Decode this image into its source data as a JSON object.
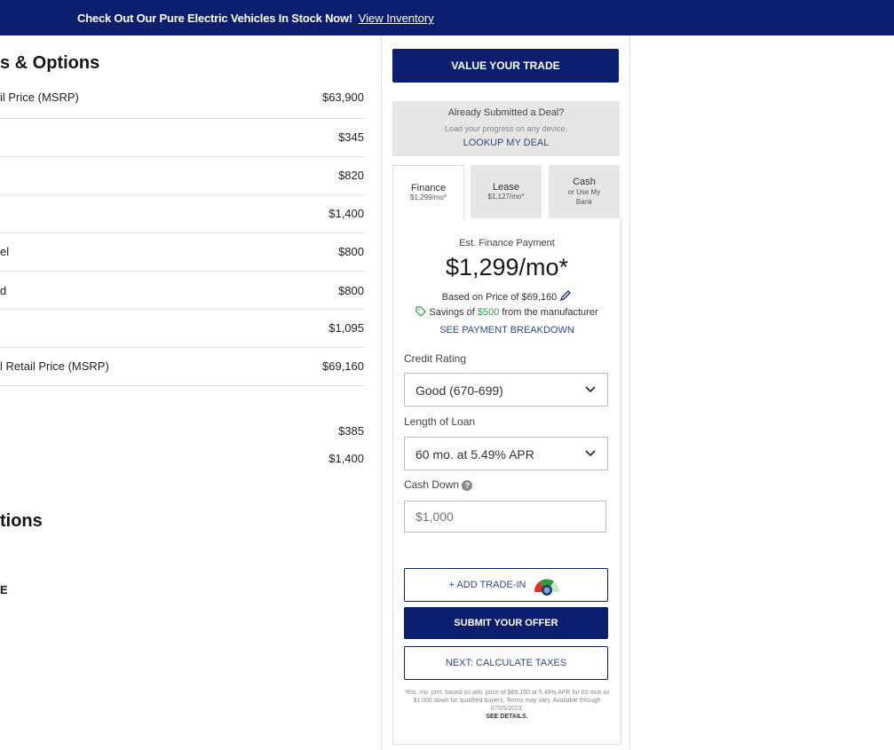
{
  "banner": {
    "message": "Check Out Our Pure Electric Vehicles In Stock Now!",
    "link": "View Inventory",
    "color": "#0b1f6e"
  },
  "pricing": {
    "section_title": "s & Options",
    "rows": [
      {
        "label": "il Price (MSRP)",
        "amount": "$63,900"
      },
      {
        "label": "",
        "amount": "$345"
      },
      {
        "label": "",
        "amount": "$820"
      },
      {
        "label": "",
        "amount": "$1,400"
      },
      {
        "label": "el",
        "amount": "$800"
      },
      {
        "label": "d",
        "amount": "$800"
      },
      {
        "label": "",
        "amount": "$1,095"
      },
      {
        "label": "l Retail Price (MSRP)",
        "amount": "$69,160"
      }
    ],
    "extra_rows": [
      {
        "label": "",
        "amount": "$385"
      },
      {
        "label": "",
        "amount": "$1,400"
      }
    ],
    "second_title": "tions",
    "fragment": "E"
  },
  "panel": {
    "value_trade": "VALUE YOUR TRADE",
    "deal": {
      "title": "Already Submitted a Deal?",
      "subtitle": "Load your progress on any device.",
      "link": "LOOKUP MY DEAL"
    },
    "tabs": [
      {
        "label": "Finance",
        "sub": "$1,299/mo*",
        "active": true
      },
      {
        "label": "Lease",
        "sub": "$1,127/mo*",
        "active": false
      },
      {
        "label": "Cash",
        "sub": "or Use My Bank",
        "active": false
      }
    ],
    "estimate": {
      "label": "Est. Finance Payment",
      "monthly": "$1,299/mo*",
      "based_prefix": "Based on Price of",
      "based_price": "$69,160",
      "savings_prefix": "Savings of",
      "savings_amount": "$500",
      "savings_suffix": "from the manufacturer",
      "breakdown": "SEE PAYMENT BREAKDOWN"
    },
    "credit": {
      "label": "Credit Rating",
      "value": "Good (670-699)"
    },
    "loan": {
      "label": "Length of Loan",
      "value": "60 mo. at 5.49% APR"
    },
    "cash_down": {
      "label": "Cash Down",
      "placeholder": "$1,000"
    },
    "add_trade": "+ ADD TRADE-IN",
    "submit": "SUBMIT YOUR OFFER",
    "next": "NEXT: CALCULATE TAXES",
    "disclaimer": "*Est. mo. pmt. based on adv. price of $69,160 at 5.49% APR for 60 mos w/ $1,000 down for qualified buyers. Terms may vary. Available through 07/05/2023.",
    "see_details": "SEE DETAILS."
  }
}
